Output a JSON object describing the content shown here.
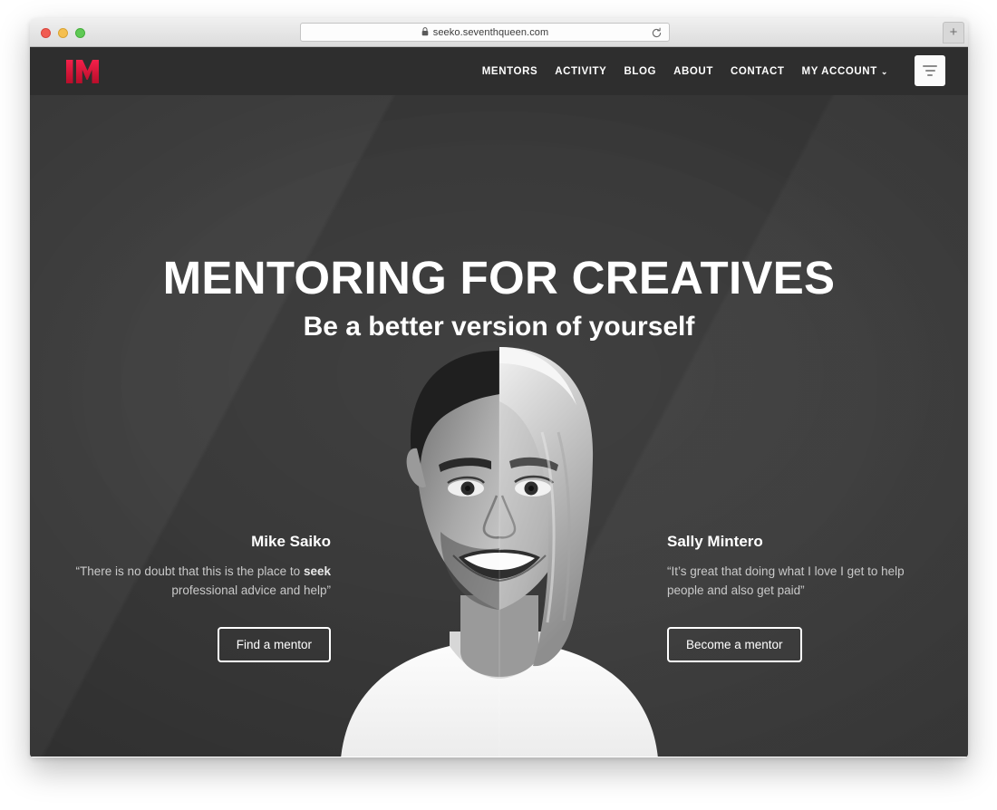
{
  "browser": {
    "url": "seeko.seventhqueen.com",
    "lock_icon": "lock-icon",
    "reload_icon": "reload-icon",
    "new_tab_label": "+",
    "traffic_lights": [
      "close-red",
      "minimize-yellow",
      "zoom-green"
    ]
  },
  "site": {
    "logo": {
      "name": "seeko-logo",
      "letter": "M",
      "color": "#e8123c"
    },
    "nav": {
      "items": [
        {
          "label": "MENTORS",
          "name": "nav-item-mentors",
          "has_dropdown": false
        },
        {
          "label": "ACTIVITY",
          "name": "nav-item-activity",
          "has_dropdown": false
        },
        {
          "label": "BLOG",
          "name": "nav-item-blog",
          "has_dropdown": false
        },
        {
          "label": "ABOUT",
          "name": "nav-item-about",
          "has_dropdown": false
        },
        {
          "label": "CONTACT",
          "name": "nav-item-contact",
          "has_dropdown": false
        },
        {
          "label": "MY ACCOUNT",
          "name": "nav-item-my-account",
          "has_dropdown": true
        }
      ],
      "dropdown_glyph": "⌄",
      "filter_button": "filter-icon"
    },
    "hero": {
      "title": "MENTORING FOR CREATIVES",
      "subtitle": "Be a better version of yourself",
      "background_color": "#3a3a3a",
      "header_color": "#2e2e2e",
      "image": "split-portrait-man-woman-black-and-white"
    },
    "testimonials": {
      "left": {
        "name": "Mike Saiko",
        "quote_before": "“There is no doubt that this is the place to ",
        "quote_bold": "seek",
        "quote_after": " professional advice and help”",
        "cta": "Find a mentor"
      },
      "right": {
        "name": "Sally Mintero",
        "quote_before": "“It’s great that doing what I love I get to help people and also get paid”",
        "quote_bold": "",
        "quote_after": "",
        "cta": "Become a mentor"
      }
    }
  }
}
